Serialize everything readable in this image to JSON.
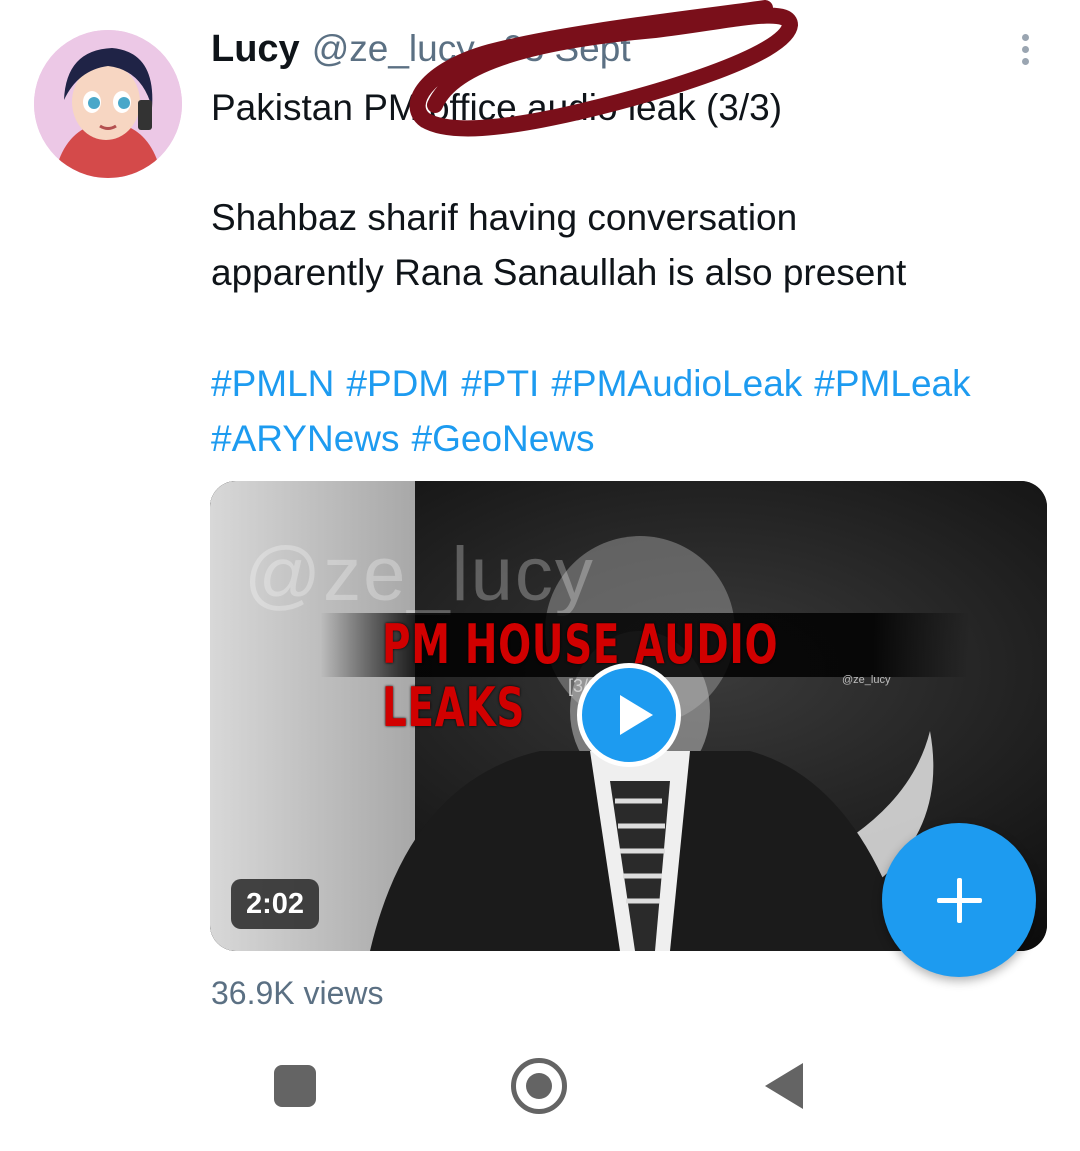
{
  "tweet": {
    "author_name": "Lucy",
    "handle": "@ze_lucy",
    "separator": "·",
    "date": "03 Sept",
    "line1": "Pakistan PM office audio leak (3/3)",
    "line2": "Shahbaz sharif having conversation",
    "line3": "apparently Rana Sanaullah is also present",
    "hashtags": [
      "#PMLN",
      "#PDM",
      "#PTI",
      "#PMAudioLeak",
      "#PMLeak",
      "#ARYNews",
      "#GeoNews"
    ],
    "views": "36.9K views"
  },
  "video": {
    "watermark": "@ze_lucy",
    "banner_title": "PM HOUSE AUDIO LEAKS",
    "subtitle": "[3/3] ...n talk",
    "mini_tag": "@ze_lucy",
    "duration": "2:02"
  },
  "icons": {
    "more": "more-vertical-icon",
    "play": "play-icon",
    "compose": "plus-icon",
    "recents": "square-icon",
    "home": "circle-icon",
    "back": "triangle-back-icon"
  },
  "colors": {
    "accent": "#1d9bf0",
    "muted": "#5b7083",
    "scribble": "#7a0f1a"
  }
}
